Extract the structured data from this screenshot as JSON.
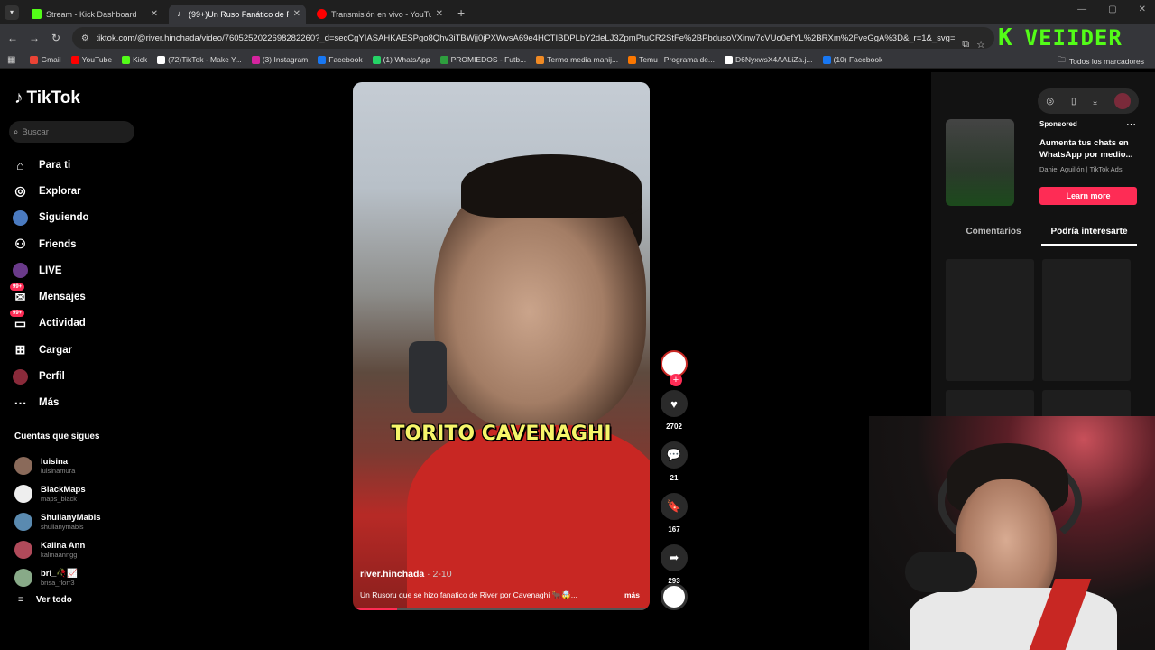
{
  "browser": {
    "tabs": [
      {
        "title": "Stream - Kick Dashboard",
        "color": "#53fc18"
      },
      {
        "title": "(99+)Un Ruso Fanático de River",
        "color": "#ffffff",
        "active": true
      },
      {
        "title": "Transmisión en vivo - YouTube",
        "color": "#ff0000"
      }
    ],
    "url": "tiktok.com/@river.hinchada/video/7605252022698282260?_d=secCgYIASAHKAESPgo8Qhv3iTBWjj0jPXWvsA69e4HCTIBDPLbY2deLJ3ZpmPtuCR2StFe%2BPbdusoVXinw7cVUo0efYL%2BRXm%2FveGgA%3D&_r=1&_svg=1&checksu...",
    "bookmarks": [
      {
        "label": "Gmail",
        "color": "#ea4335"
      },
      {
        "label": "YouTube",
        "color": "#ff0000"
      },
      {
        "label": "Kick",
        "color": "#53fc18"
      },
      {
        "label": "(72)TikTok - Make Y...",
        "color": "#ffffff"
      },
      {
        "label": "(3) Instagram",
        "color": "#d6249f"
      },
      {
        "label": "Facebook",
        "color": "#1877f2"
      },
      {
        "label": "(1) WhatsApp",
        "color": "#25d366"
      },
      {
        "label": "PROMIEDOS - Futb...",
        "color": "#2e9e3e"
      },
      {
        "label": "Termo media manij...",
        "color": "#f08a24"
      },
      {
        "label": "Temu | Programa de...",
        "color": "#fb7701"
      },
      {
        "label": "D6NyxwsX4AALiZa.j...",
        "color": "#ffffff"
      },
      {
        "label": "(10) Facebook",
        "color": "#1877f2"
      }
    ],
    "all_bookmarks": "Todos los marcadores"
  },
  "overlay": {
    "kick_letter": "K",
    "kick_word": "VEIIDER"
  },
  "tiktok": {
    "logo": "TikTok",
    "search_placeholder": "Buscar",
    "nav": [
      {
        "label": "Para ti",
        "icon": "home-icon"
      },
      {
        "label": "Explorar",
        "icon": "compass-icon"
      },
      {
        "label": "Siguiendo",
        "icon": "following-avatar-icon"
      },
      {
        "label": "Friends",
        "icon": "friends-icon"
      },
      {
        "label": "LIVE",
        "icon": "live-icon"
      },
      {
        "label": "Mensajes",
        "icon": "messages-icon",
        "badge": "99+"
      },
      {
        "label": "Actividad",
        "icon": "activity-icon",
        "badge": "99+"
      },
      {
        "label": "Cargar",
        "icon": "upload-icon"
      },
      {
        "label": "Perfil",
        "icon": "profile-icon"
      },
      {
        "label": "Más",
        "icon": "more-icon"
      }
    ],
    "following_title": "Cuentas que sigues",
    "following": [
      {
        "name": "luisina",
        "handle": "luisinam0ra",
        "color": "#8a6a5a"
      },
      {
        "name": "BlackMaps",
        "handle": "maps_black",
        "color": "#eeeeee"
      },
      {
        "name": "ShulianyMabis",
        "handle": "shulianymabis",
        "color": "#5a8ab0"
      },
      {
        "name": "Kalina Ann",
        "handle": "kalinaanngg",
        "color": "#b04a5a"
      },
      {
        "name": "bri_🥀📈",
        "handle": "brisa_florr3",
        "color": "#88aa88"
      }
    ],
    "see_all": "Ver todo"
  },
  "video": {
    "caption": "TORITO CAVENAGHI",
    "author": "river.hinchada",
    "date": "2-10",
    "description": "Un Rusoru que se hizo fanatico de River por Cavenaghi 🐂🤯...",
    "more": "más",
    "progress": 0.15,
    "likes": "2702",
    "comments": "21",
    "saves": "167",
    "shares": "293"
  },
  "ad": {
    "sponsored": "Sponsored",
    "title": "Aumenta tus chats en WhatsApp por medio...",
    "by": "Daniel Aguillón | TikTok Ads",
    "cta": "Learn more"
  },
  "right_tabs": {
    "comments": "Comentarios",
    "suggested": "Podría interesarte"
  }
}
